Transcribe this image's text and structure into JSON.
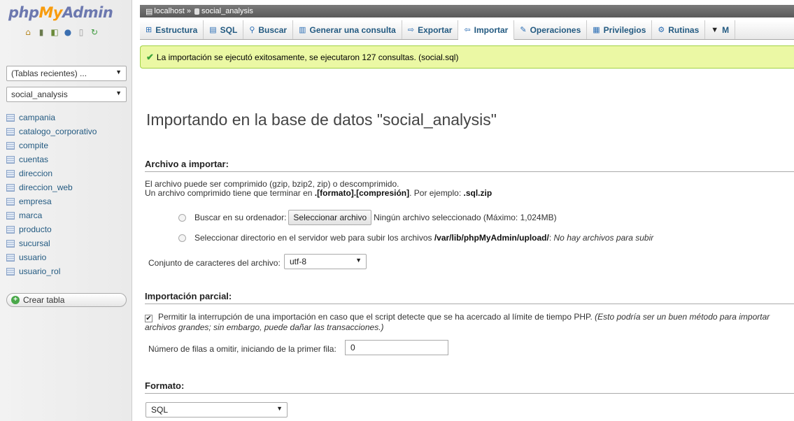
{
  "sidebar": {
    "logo_php": "php",
    "logo_my": "My",
    "logo_admin": "Admin",
    "quick_icons": [
      "home-icon",
      "logout-icon",
      "query-icon",
      "help-icon",
      "docs-icon",
      "reload-icon"
    ],
    "recent_tables": "(Tablas recientes) ...",
    "database": "social_analysis",
    "tables": [
      "campania",
      "catalogo_corporativo",
      "compite",
      "cuentas",
      "direccion",
      "direccion_web",
      "empresa",
      "marca",
      "producto",
      "sucursal",
      "usuario",
      "usuario_rol"
    ],
    "create_table": "Crear tabla"
  },
  "breadcrumb": {
    "server": "localhost",
    "separator": "»",
    "database": "social_analysis"
  },
  "tabs": [
    {
      "label": "Estructura",
      "icon": "structure-icon"
    },
    {
      "label": "SQL",
      "icon": "sql-icon"
    },
    {
      "label": "Buscar",
      "icon": "search-icon"
    },
    {
      "label": "Generar una consulta",
      "icon": "query-icon"
    },
    {
      "label": "Exportar",
      "icon": "export-icon"
    },
    {
      "label": "Importar",
      "icon": "import-icon",
      "active": true
    },
    {
      "label": "Operaciones",
      "icon": "wrench-icon"
    },
    {
      "label": "Privilegios",
      "icon": "privileges-icon"
    },
    {
      "label": "Rutinas",
      "icon": "routines-icon"
    },
    {
      "label": "M",
      "icon": "more-icon"
    }
  ],
  "success_message": "La importación se ejecutó exitosamente, se ejecutaron 127 consultas. (social.sql)",
  "main": {
    "title": "Importando en la base de datos \"social_analysis\"",
    "file_section": {
      "heading": "Archivo a importar:",
      "desc1": "El archivo puede ser comprimido (gzip, bzip2, zip) o descomprimido.",
      "desc2_prefix": "Un archivo comprimido tiene que terminar en ",
      "desc2_format": ".[formato].[compresión]",
      "desc2_mid": ". Por ejemplo: ",
      "desc2_example": ".sql.zip",
      "browse_label": "Buscar en su ordenador:",
      "browse_button": "Seleccionar archivo",
      "browse_status": "Ningún archivo seleccionado (Máximo: 1,024MB)",
      "dir_label": "Seleccionar directorio en el servidor web para subir los archivos ",
      "dir_path": "/var/lib/phpMyAdmin/upload/",
      "dir_colon": ": ",
      "dir_note": "No hay archivos para subir",
      "charset_label": "Conjunto de caracteres del archivo:",
      "charset_value": "utf-8"
    },
    "partial_section": {
      "heading": "Importación parcial:",
      "allow_interrupt": "Permitir la interrupción de una importación en caso que el script detecte que se ha acercado al límite de tiempo PHP.",
      "allow_interrupt_note": "(Esto podría ser un buen método para importar archivos grandes; sin embargo, puede dañar las transacciones.)",
      "skip_label": "Número de filas a omitir, iniciando de la primer fila:",
      "skip_value": "0"
    },
    "format_section": {
      "heading": "Formato:",
      "format_value": "SQL"
    }
  },
  "colors": {
    "link": "#235a81",
    "success_bg": "#ebf8a4",
    "success_border": "#a2d246",
    "logo_blue": "#6c78af",
    "logo_orange": "#f89c0e"
  }
}
